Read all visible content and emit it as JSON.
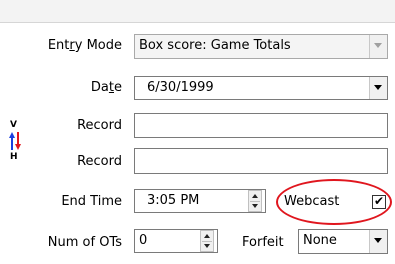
{
  "form": {
    "entry_mode": {
      "label_pre": "Ent",
      "label_ul": "r",
      "label_post": "y Mode",
      "value": "Box score: Game Totals"
    },
    "date": {
      "label_pre": "Da",
      "label_ul": "t",
      "label_post": "e",
      "value": "6/30/1999"
    },
    "record_visitor": {
      "label": "Record",
      "value": ""
    },
    "record_home": {
      "label": "Record",
      "value": ""
    },
    "end_time": {
      "label": "End Time",
      "value": "3:05 PM"
    },
    "webcast": {
      "label": "Webcast",
      "checked": true,
      "check_glyph": "✔"
    },
    "num_ots": {
      "label": "Num of OTs",
      "value": "0"
    },
    "forfeit": {
      "label": "Forfeit",
      "value": "None"
    },
    "vh_indicator": {
      "top_letter": "V",
      "bottom_letter": "H",
      "colors": {
        "up": "#1a3fe0",
        "down": "#e0161e"
      }
    }
  },
  "accent": {
    "highlight_circle": "#e0161e"
  }
}
